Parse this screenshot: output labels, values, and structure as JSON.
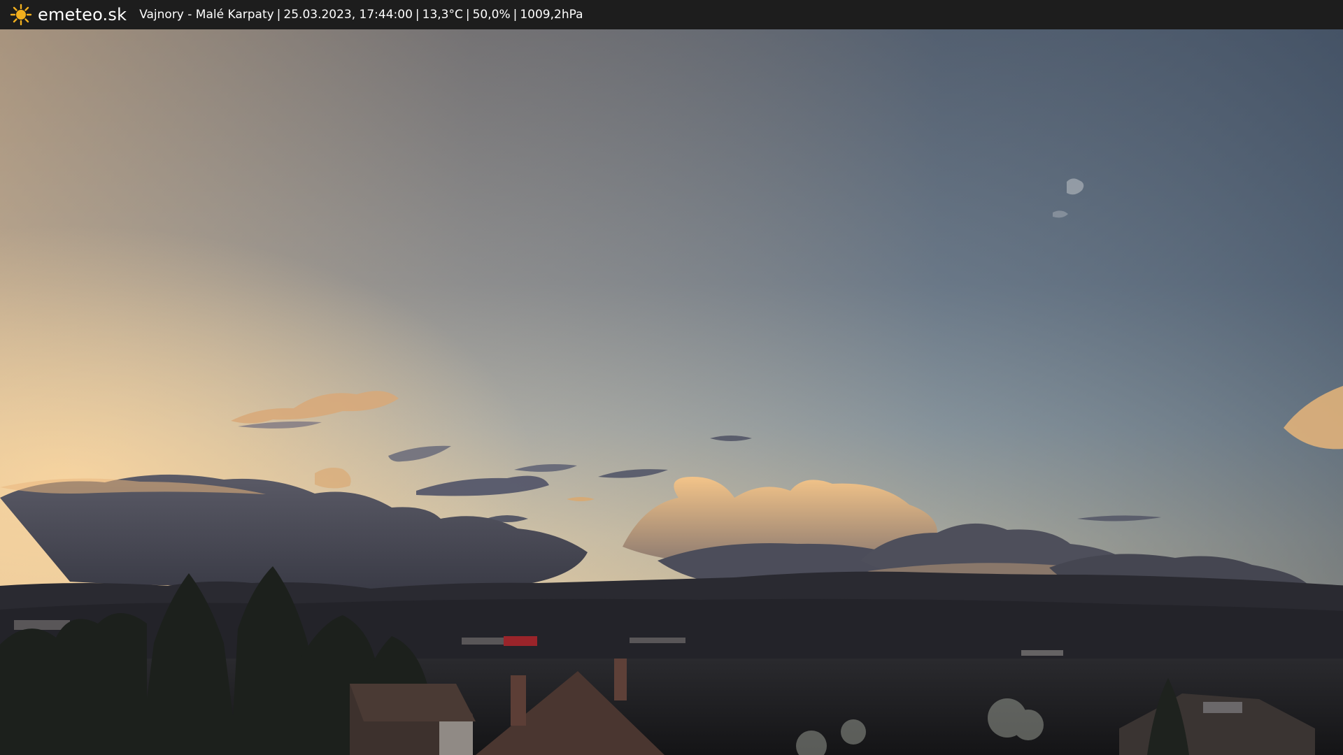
{
  "header": {
    "brand": "emeteo.sk",
    "brand_icon": "sun-icon",
    "location": "Vajnory - Malé Karpaty",
    "datetime": "25.03.2023, 17:44:00",
    "temperature": "13,3°C",
    "humidity": "50,0%",
    "pressure": "1009,2hPa",
    "separator": "|"
  },
  "colors": {
    "bar_background": "#1d1d1d",
    "sun_icon": "#f2b01e",
    "sky_top": "#4f5868",
    "sky_horizon_warm": "#f0c48a",
    "sky_right": "#55687a",
    "cloud_dark": "#454650",
    "cloud_lit": "#e9b878",
    "hills": "#26262b",
    "ground": "#1b1b1e"
  }
}
